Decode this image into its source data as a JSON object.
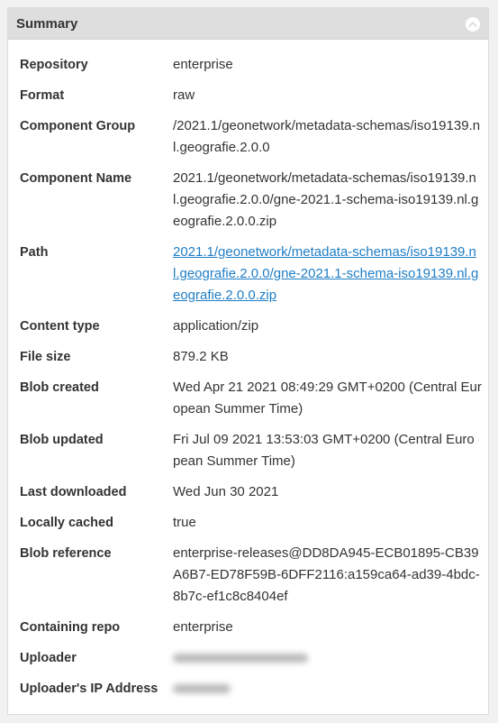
{
  "panel": {
    "title": "Summary",
    "collapse_icon": "chevron-up-circle-icon"
  },
  "colors": {
    "header_bg": "#dedede",
    "link": "#1f7ec6",
    "text": "#333333"
  },
  "rows": [
    {
      "key": "repository",
      "label": "Repository",
      "value": "enterprise",
      "style": "text"
    },
    {
      "key": "format",
      "label": "Format",
      "value": "raw",
      "style": "text"
    },
    {
      "key": "component-group",
      "label": "Component Group",
      "value": "/2021.1/geonetwork/metadata-schemas/iso19139.nl.geografie.2.0.0",
      "style": "text"
    },
    {
      "key": "component-name",
      "label": "Component Name",
      "value": "2021.1/geonetwork/metadata-schemas/iso19139.nl.geografie.2.0.0/gne-2021.1-schema-iso19139.nl.geografie.2.0.0.zip",
      "style": "text"
    },
    {
      "key": "path",
      "label": "Path",
      "value": "2021.1/geonetwork/metadata-schemas/iso19139.nl.geografie.2.0.0/gne-2021.1-schema-iso19139.nl.geografie.2.0.0.zip",
      "style": "link"
    },
    {
      "key": "content-type",
      "label": "Content type",
      "value": "application/zip",
      "style": "text"
    },
    {
      "key": "file-size",
      "label": "File size",
      "value": "879.2 KB",
      "style": "text"
    },
    {
      "key": "blob-created",
      "label": "Blob created",
      "value": "Wed Apr 21 2021 08:49:29 GMT+0200 (Central European Summer Time)",
      "style": "text"
    },
    {
      "key": "blob-updated",
      "label": "Blob updated",
      "value": "Fri Jul 09 2021 13:53:03 GMT+0200 (Central European Summer Time)",
      "style": "text"
    },
    {
      "key": "last-downloaded",
      "label": "Last downloaded",
      "value": "Wed Jun 30 2021",
      "style": "text"
    },
    {
      "key": "locally-cached",
      "label": "Locally cached",
      "value": "true",
      "style": "text"
    },
    {
      "key": "blob-reference",
      "label": "Blob reference",
      "value": "enterprise-releases@DD8DA945-ECB01895-CB39A6B7-ED78F59B-6DFF2116:a159ca64-ad39-4bdc-8b7c-ef1c8c8404ef",
      "style": "text"
    },
    {
      "key": "containing-repo",
      "label": "Containing repo",
      "value": "enterprise",
      "style": "text"
    },
    {
      "key": "uploader",
      "label": "Uploader",
      "value": "",
      "style": "redacted"
    },
    {
      "key": "uploader-ip-address",
      "label": "Uploader's IP Address",
      "value": "",
      "style": "redacted"
    }
  ]
}
